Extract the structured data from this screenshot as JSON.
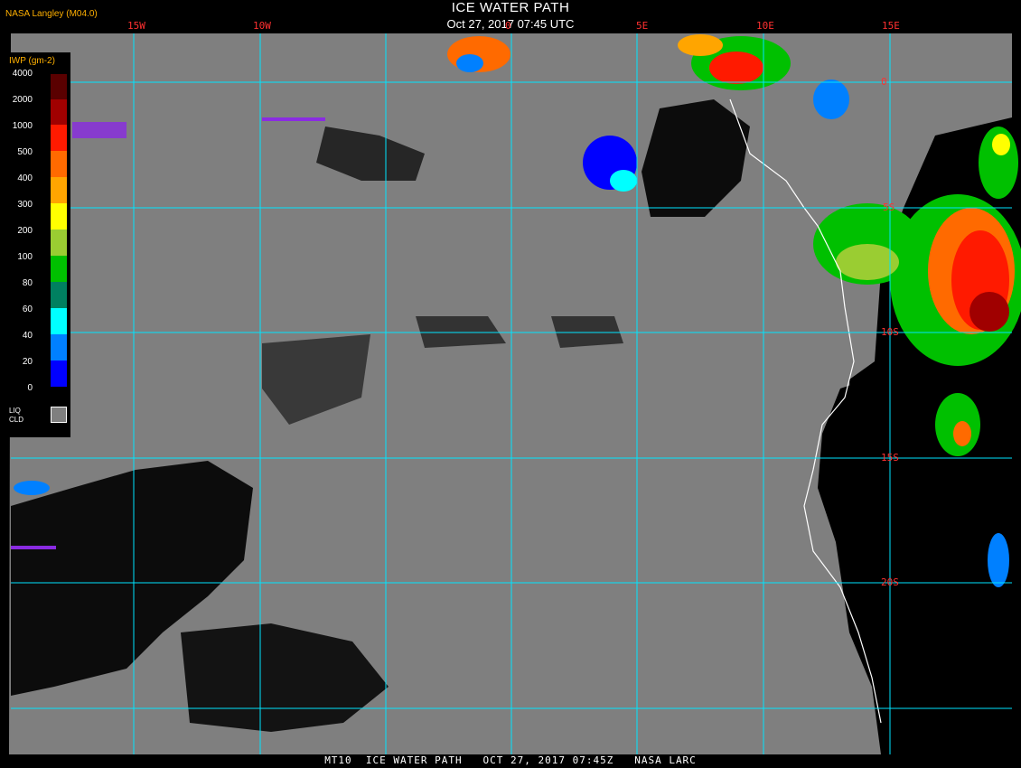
{
  "header": {
    "title": "ICE WATER PATH",
    "subtitle": "Oct 27, 2017 07:45 UTC",
    "org": "NASA Langley (M04.0)"
  },
  "map": {
    "lon_labels": [
      "15W",
      "10W",
      "0",
      "5E",
      "10E",
      "15E"
    ],
    "lat_labels": [
      "0",
      "5S",
      "10S",
      "15S",
      "20S"
    ]
  },
  "legend": {
    "title": "IWP (gm-2)",
    "levels": [
      "4000",
      "2000",
      "1000",
      "500",
      "400",
      "300",
      "200",
      "100",
      "80",
      "60",
      "40",
      "20",
      "0"
    ],
    "colors": [
      "#5a0000",
      "#a00000",
      "#ff1a00",
      "#ff6a00",
      "#ffa500",
      "#ffff00",
      "#9acd32",
      "#00c000",
      "#008060",
      "#00ffff",
      "#0080ff",
      "#0000ff",
      "#8a2be2"
    ],
    "liq_label_1": "LIQ",
    "liq_label_2": "CLD",
    "liq_color": "#7f7f7f"
  },
  "colors": {
    "grid": "#00e5ff",
    "cloud_gray": "#7f7f7f",
    "label_red": "#ff3030",
    "coast": "#ffffff"
  },
  "footer": "MT10  ICE WATER PATH   OCT 27, 2017 07:45Z   NASA LARC"
}
